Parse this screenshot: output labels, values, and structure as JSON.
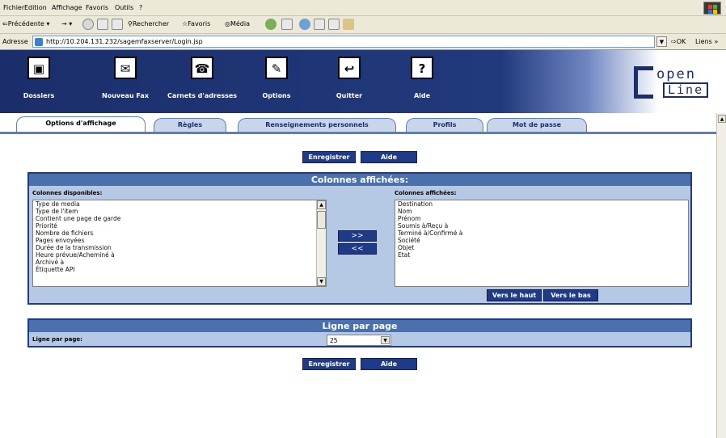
{
  "menu": [
    "Fichier",
    "Edition",
    "Affichage",
    "Favoris",
    "Outils",
    "?"
  ],
  "toolbar": {
    "back": "Précédente",
    "search": "Rechercher",
    "favorites": "Favoris",
    "media": "Média"
  },
  "address": {
    "label": "Adresse",
    "url": "http://10.204.131.232/sagemfaxserver/Login.jsp",
    "go": "OK",
    "links": "Liens »"
  },
  "nav": [
    {
      "label": "Dossiers",
      "icon": "folder-icon",
      "glyph": "▣"
    },
    {
      "label": "Nouveau Fax",
      "icon": "fax-icon",
      "glyph": "✉"
    },
    {
      "label": "Carnets d'adresses",
      "icon": "phone-icon",
      "glyph": "☎"
    },
    {
      "label": "Options",
      "icon": "wrench-icon",
      "glyph": "✎"
    },
    {
      "label": "Quitter",
      "icon": "exit-icon",
      "glyph": "↩"
    },
    {
      "label": "Aide",
      "icon": "help-icon",
      "glyph": "?"
    }
  ],
  "logo": {
    "line1": "open",
    "line2": "Line"
  },
  "tabs": [
    "Options d'affichage",
    "Règles",
    "Renseignements personnels",
    "Profils",
    "Mot de passe"
  ],
  "buttons": {
    "save": "Enregistrer",
    "help": "Aide",
    "move_right": ">>",
    "move_left": "<<",
    "up": "Vers le haut",
    "down": "Vers le bas"
  },
  "columns_panel": {
    "title": "Colonnes affichées:",
    "available_label": "Colonnes disponibles:",
    "displayed_label": "Colonnes affichées:",
    "available": [
      "Type de media",
      "Type de l'item",
      "Contient une page de garde",
      "Priorité",
      "Nombre de fichiers",
      "Pages envoyées",
      "Durée de la transmission",
      "Heure prévue/Acheminé à",
      "Archivé à",
      "Étiquette API"
    ],
    "displayed": [
      "Destination",
      "Nom",
      "Prénom",
      "Soumis à/Reçu à",
      "Terminé à/Confirmé à",
      "Société",
      "Objet",
      "Etat"
    ]
  },
  "lines_panel": {
    "title": "Ligne par page",
    "label": "Ligne par page:",
    "value": "25"
  }
}
